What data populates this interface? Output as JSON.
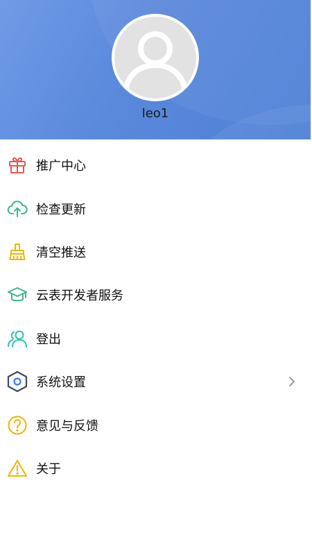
{
  "profile": {
    "username": "leo1"
  },
  "colors": {
    "header_gradient_start": "#6f9be6",
    "header_gradient_end": "#4f80d6",
    "gift_icon": "#e05a4f",
    "update_icon": "#3bb58d",
    "clear_icon": "#f0b400",
    "developer_icon": "#3bb58d",
    "logout_icon": "#2fc3b0",
    "settings_icon_outer": "#3b4a66",
    "settings_icon_inner": "#3d7be0",
    "feedback_icon": "#f0b400",
    "about_icon": "#f0b400"
  },
  "menu": {
    "items": [
      {
        "label": "推广中心",
        "icon": "gift-icon",
        "has_arrow": false
      },
      {
        "label": "检查更新",
        "icon": "cloud-upload-icon",
        "has_arrow": false
      },
      {
        "label": "清空推送",
        "icon": "broom-icon",
        "has_arrow": false
      },
      {
        "label": "云表开发者服务",
        "icon": "graduation-cap-icon",
        "has_arrow": false
      },
      {
        "label": "登出",
        "icon": "users-icon",
        "has_arrow": false
      },
      {
        "label": "系统设置",
        "icon": "hexagon-settings-icon",
        "has_arrow": true
      },
      {
        "label": "意见与反馈",
        "icon": "question-circle-icon",
        "has_arrow": false
      },
      {
        "label": "关于",
        "icon": "warning-icon",
        "has_arrow": false
      }
    ]
  }
}
